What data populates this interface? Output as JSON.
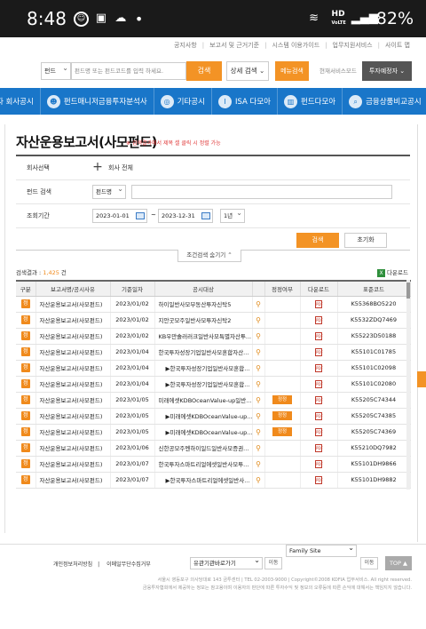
{
  "statusbar": {
    "time": "8:48",
    "battery": "82%",
    "network": "HD",
    "network_sub": "VoLTE"
  },
  "toplinks": [
    "공지사항",
    "보고서 및 근거기준",
    "시스템 이용가이드",
    "업무지원서비스",
    "사이트 맵"
  ],
  "search": {
    "category": "펀드",
    "placeholder": "펀드명 또는 펀드코드를 입력 하세요.",
    "search_label": "검색",
    "detail_label": "상세 검색",
    "menu_label": "메뉴검색",
    "current_service_label": "현재서비스모드",
    "investor_label": "투자예정자"
  },
  "nav": [
    "자 회사공시",
    "펀드매니저금융투자분석사",
    "기타공시",
    "ISA 다모아",
    "펀드다모아",
    "금융상품비교공시"
  ],
  "page": {
    "title": "자산운용보고서(사모펀드)",
    "note": "※ 검색결과에서 제목 셀 클릭 시 정렬 가능"
  },
  "filter": {
    "company_label": "회사선택",
    "company_value": "회사 전체",
    "fund_label": "펀드 검색",
    "fund_select": "펀드명",
    "period_label": "조회기간",
    "date_from": "2023-01-01",
    "date_to": "2023-12-31",
    "period_select": "1년",
    "query_label": "검색",
    "reset_label": "초기화",
    "hide_label": "조건검색 숨기기 ⌃"
  },
  "result": {
    "prefix": "검색결과 : ",
    "count": "1,425",
    "suffix": " 건",
    "download_label": "다운로드"
  },
  "table": {
    "headers": [
      "구분",
      "보고서명/공시사유",
      "기준일자",
      "공시대상",
      "",
      "정정여부",
      "다운로드",
      "표준코드"
    ],
    "rows": [
      {
        "badge": "정",
        "name": "자산운용보고서(사모펀드)",
        "date": "2023/01/02",
        "target": "하이일반사모부동산투자신탁5",
        "sub": false,
        "corr": "",
        "code": "K55368BO5220"
      },
      {
        "badge": "정",
        "name": "자산운용보고서(사모펀드)",
        "date": "2023/01/02",
        "target": "지안굿모주일반사모투자신탁2",
        "sub": false,
        "corr": "",
        "code": "K5532ZDQ7469"
      },
      {
        "badge": "정",
        "name": "자산운용보고서(사모펀드)",
        "date": "2023/01/02",
        "target": "KB우만솔러러크일반사모특별자산투...",
        "sub": false,
        "corr": "",
        "code": "K55223D50188"
      },
      {
        "badge": "정",
        "name": "자산운용보고서(사모펀드)",
        "date": "2023/01/04",
        "target": "한국투자성장기업일반사모혼합자산...",
        "sub": false,
        "corr": "",
        "code": "K55101C01785"
      },
      {
        "badge": "정",
        "name": "자산운용보고서(사모펀드)",
        "date": "2023/01/04",
        "target": "▶한국투자성장기업일반사모혼합...",
        "sub": true,
        "corr": "",
        "code": "K55101C02098"
      },
      {
        "badge": "정",
        "name": "자산운용보고서(사모펀드)",
        "date": "2023/01/04",
        "target": "▶한국투자성장기업일반사모혼합...",
        "sub": true,
        "corr": "",
        "code": "K55101C02080"
      },
      {
        "badge": "정",
        "name": "자산운용보고서(사모펀드)",
        "date": "2023/01/05",
        "target": "미래에셋KDBOceanValue-up일반...",
        "sub": false,
        "corr": "정정",
        "code": "K55205C74344"
      },
      {
        "badge": "정",
        "name": "자산운용보고서(사모펀드)",
        "date": "2023/01/05",
        "target": "▶미래에셋KDBOceanValue-up...",
        "sub": true,
        "corr": "정정",
        "code": "K55205C74385"
      },
      {
        "badge": "정",
        "name": "자산운용보고서(사모펀드)",
        "date": "2023/01/05",
        "target": "▶미래에셋KDBOceanValue-up...",
        "sub": true,
        "corr": "정정",
        "code": "K55205C74369"
      },
      {
        "badge": "정",
        "name": "자산운용보고서(사모펀드)",
        "date": "2023/01/06",
        "target": "신한공모주멘하이일드일반사모증권...",
        "sub": false,
        "corr": "",
        "code": "K55210DQ7982"
      },
      {
        "badge": "정",
        "name": "자산운용보고서(사모펀드)",
        "date": "2023/01/07",
        "target": "한국투자스마트리얼에셋일반사모투...",
        "sub": false,
        "corr": "",
        "code": "K55101DH9866"
      },
      {
        "badge": "정",
        "name": "자산운용보고서(사모펀드)",
        "date": "2023/01/07",
        "target": "▶한국투자스마트리얼에셋일반사...",
        "sub": true,
        "corr": "",
        "code": "K55101DH9882"
      }
    ]
  },
  "footer": {
    "privacy": "개인정보처리방침",
    "email": "이메일무단수집거부",
    "related_select": "유관기관바로가기",
    "family_select": "Family Site",
    "go_label": "이동",
    "top_label": "TOP ▲",
    "address": "서울시 영등포구 의사당대로 143 금투센터 | TEL 02-2003-9000 | Copyright©2008 KOFIA 업무서비스. All right reserved.",
    "disclaimer": "금융투자협회에서 제공하는 정보는 참고용이며 이용자의 판단에 따른 투자수익 및 정보의 오류등에 따른 손익에 대해서는 책임지지 않습니다."
  },
  "colors": {
    "accent": "#f39325",
    "nav": "#1976c9"
  }
}
